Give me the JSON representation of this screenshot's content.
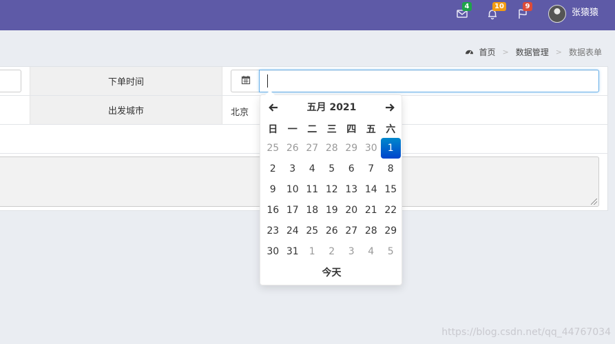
{
  "topbar": {
    "color": "#5e5aa7",
    "mail": {
      "icon": "envelope-icon",
      "badge": "4",
      "badge_color": "#1fa34a"
    },
    "notifications": {
      "icon": "bell-icon",
      "badge": "10",
      "badge_color": "#f39c12"
    },
    "flags": {
      "icon": "flag-icon",
      "badge": "9",
      "badge_color": "#dd4b39"
    },
    "user": {
      "name": "张猿猿",
      "avatar": "user-avatar"
    }
  },
  "breadcrumb": {
    "items": [
      "首页",
      "数据管理",
      "数据表单"
    ],
    "separator": ">",
    "icon": "dashboard-icon"
  },
  "form": {
    "order_time_label": "下单时间",
    "departure_city_label": "出发城市",
    "departure_city_value": "北京",
    "date_value": "",
    "calendar_icon": "calendar-icon"
  },
  "datepicker": {
    "title": "五月 2021",
    "weekdays": [
      "日",
      "一",
      "二",
      "三",
      "四",
      "五",
      "六"
    ],
    "weeks": [
      [
        "25",
        "26",
        "27",
        "28",
        "29",
        "30",
        "1"
      ],
      [
        "2",
        "3",
        "4",
        "5",
        "6",
        "7",
        "8"
      ],
      [
        "9",
        "10",
        "11",
        "12",
        "13",
        "14",
        "15"
      ],
      [
        "16",
        "17",
        "18",
        "19",
        "20",
        "21",
        "22"
      ],
      [
        "23",
        "24",
        "25",
        "26",
        "27",
        "28",
        "29"
      ],
      [
        "30",
        "31",
        "1",
        "2",
        "3",
        "4",
        "5"
      ]
    ],
    "selected": "1",
    "today_label": "今天",
    "active_color": "#0066cc"
  },
  "watermark": "https://blog.csdn.net/qq_44767034"
}
